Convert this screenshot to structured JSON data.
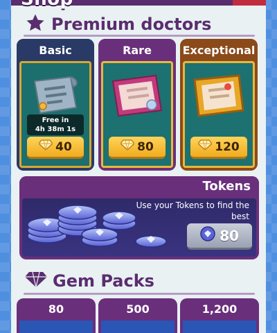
{
  "header": {
    "title": "Shop"
  },
  "premium": {
    "title": "Premium doctors",
    "cards": [
      {
        "label": "Basic",
        "free_line1": "Free in",
        "free_line2": "4h 38m 1s",
        "price": "40"
      },
      {
        "label": "Rare",
        "price": "80"
      },
      {
        "label": "Exceptional",
        "price": "120"
      }
    ]
  },
  "tokens": {
    "title": "Tokens",
    "description": "Use your Tokens to find the best",
    "price": "80"
  },
  "gem_packs": {
    "title": "Gem Packs",
    "packs": [
      {
        "label": "80"
      },
      {
        "label": "500"
      },
      {
        "label": "1,200"
      }
    ]
  },
  "colors": {
    "purple": "#5a2d6e",
    "gold": "#f0ac1f",
    "teal": "#1d7170",
    "navy": "#2a3a66",
    "brown": "#8b4a1a"
  }
}
